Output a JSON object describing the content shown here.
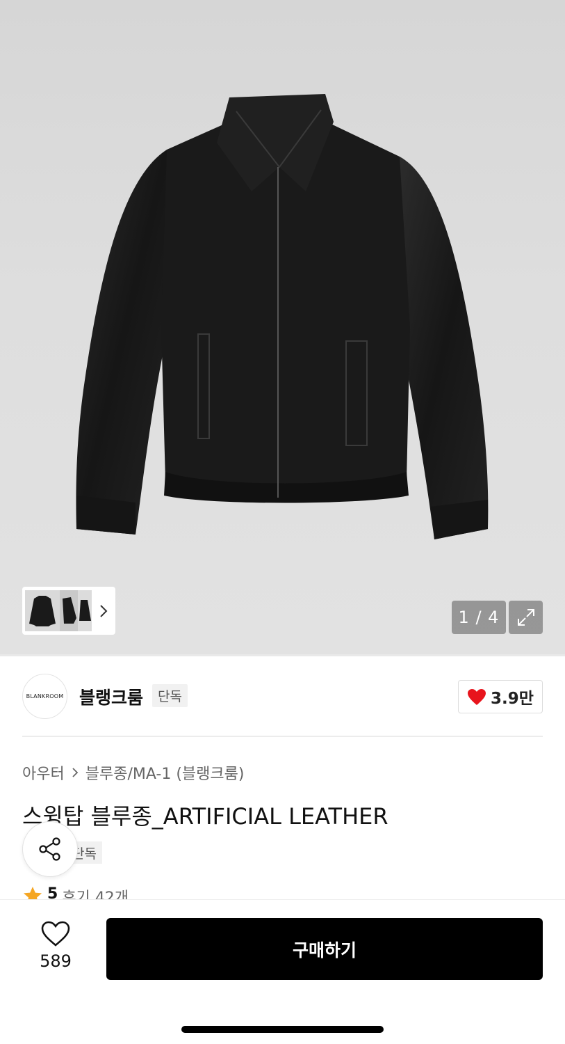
{
  "gallery": {
    "counter": "1 / 4",
    "thumbnails": [
      "jacket-front",
      "jacket-side",
      "jacket-back"
    ],
    "expand_icon": "expand-icon",
    "next_icon": "chevron-right-icon"
  },
  "brand": {
    "logo_text": "BLANKROOM",
    "name": "블랭크룸",
    "badge": "단독",
    "likes": "3.9만",
    "like_icon": "heart-filled-icon",
    "like_color": "#e8141c"
  },
  "product": {
    "breadcrumb": [
      "아우터",
      "블루종/MA-1 (블랭크룸)"
    ],
    "title": "스윙탑 블루종_ARTIFICIAL LEATHER",
    "tag": "단독",
    "rating_score": "5",
    "rating_reviews": "후기 42개",
    "star_color": "#f5a623"
  },
  "bottom_bar": {
    "wish_count": "589",
    "wish_icon": "heart-outline-icon",
    "buy_label": "구매하기"
  }
}
